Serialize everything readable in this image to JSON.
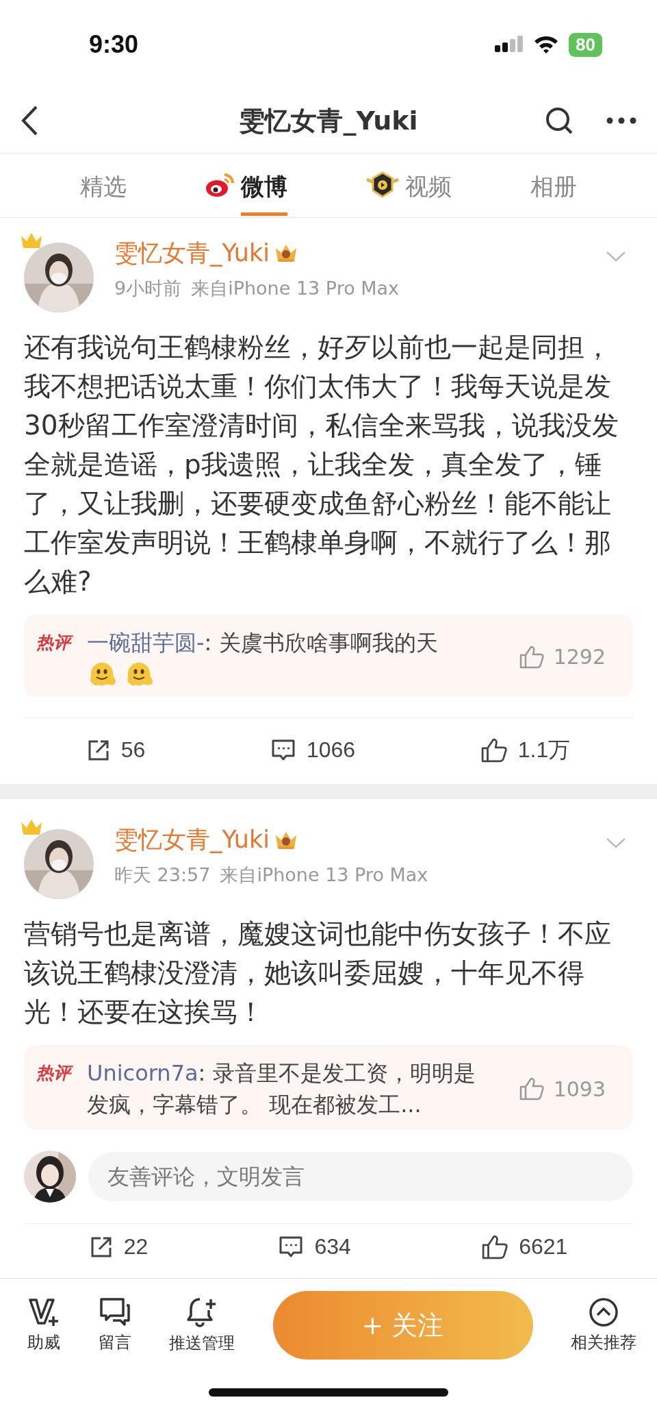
{
  "status_bar": {
    "time": "9:30",
    "battery": "80"
  },
  "nav": {
    "title": "雯忆女青_Yuki"
  },
  "tabs": [
    {
      "label": "精选",
      "selected": false,
      "kind": "plain"
    },
    {
      "label": "微博",
      "selected": true,
      "kind": "weibo"
    },
    {
      "label": "视频",
      "selected": false,
      "kind": "video"
    },
    {
      "label": "相册",
      "selected": false,
      "kind": "plain"
    }
  ],
  "posts": [
    {
      "author": "雯忆女青_Yuki",
      "time": "9小时前",
      "source": "来自iPhone 13 Pro Max",
      "text": "还有我说句王鹤棣粉丝，好歹以前也一起是同担，我不想把话说太重！你们太伟大了！我每天说是发 30秒留工作室澄清时间，私信全来骂我，说我没发全就是造谣，p我遗照，让我全发，真全发了，锤了，又让我删，还要硬变成鱼舒心粉丝！能不能让工作室发声明说！王鹤棣单身啊，不就行了么！那么难?",
      "hot_comment": {
        "badge": "热评",
        "user": "一碗甜芋圆-",
        "text": ": 关虞书欣啥事啊我的天",
        "emojis": [
          {
            "kind": "melting"
          },
          {
            "kind": "melting"
          }
        ],
        "likes": "1292"
      },
      "reposts": "56",
      "comments": "1066",
      "likes": "1.1万"
    },
    {
      "author": "雯忆女青_Yuki",
      "time": "昨天 23:57",
      "source": "来自iPhone 13 Pro Max",
      "text": "营销号也是离谱，魔嫂这词也能中伤女孩子！不应该说王鹤棣没澄清，她该叫委屈嫂，十年见不得光！还要在这挨骂！",
      "hot_comment": {
        "badge": "热评",
        "user": "Unicorn7a",
        "text": ": 录音里不是发工资，明明是发疯，字幕错了。 现在都被发工...",
        "likes": "1093"
      },
      "comment_input": {
        "placeholder": "友善评论，文明发言"
      },
      "reposts": "22",
      "comments": "634",
      "likes": "6621"
    }
  ],
  "bottom_bar": {
    "items": [
      {
        "label": "助威",
        "kind": "cheer"
      },
      {
        "label": "留言",
        "kind": "message"
      },
      {
        "label": "推送管理",
        "kind": "bell"
      }
    ],
    "follow_button": "+ 关注",
    "related": "相关推荐"
  }
}
